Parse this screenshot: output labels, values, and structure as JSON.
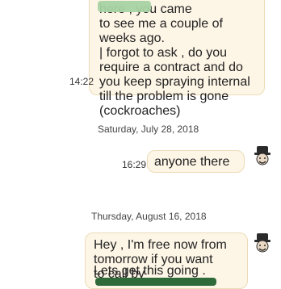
{
  "conversation": {
    "messages": [
      {
        "text": "here , you came\nto see me a couple of\nweeks ago.\n| forgot to ask , do you\nrequire a contract and do\nyou keep spraying internal\ntill the problem is gone\n(cockroaches)",
        "time": "14:22"
      },
      {
        "date": "Saturday, July 28, 2018",
        "text": "anyone there",
        "time": "16:29"
      },
      {
        "date": "Thursday, August 16, 2018",
        "text": "Hey , I'm free now from\ntomorrow if you want\nto call by",
        "text2": "Lets get this going ."
      }
    ]
  },
  "colors": {
    "bubble_bg": "#fdf5e6",
    "bubble_border": "#ecdcb8"
  },
  "icons": {
    "avatar": "chef-hat-avatar-icon",
    "redaction": "redacted-text-blob"
  }
}
